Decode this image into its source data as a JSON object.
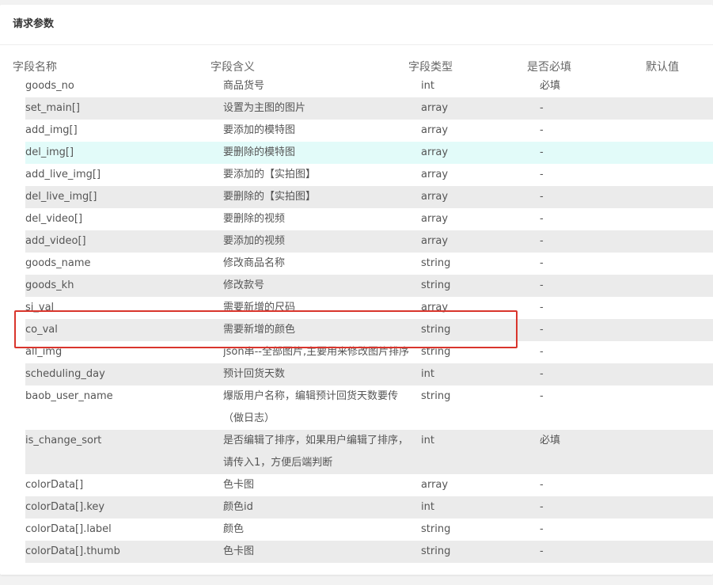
{
  "section": {
    "title": "请求参数"
  },
  "columns": {
    "name": "字段名称",
    "meaning": "字段含义",
    "type": "字段类型",
    "required": "是否必填",
    "default": "默认值"
  },
  "rows": [
    {
      "name": "goods_no",
      "desc": "商品货号",
      "type": "int",
      "required": "必填"
    },
    {
      "name": "set_main[]",
      "desc": "设置为主图的图片",
      "type": "array",
      "required": "-"
    },
    {
      "name": "add_img[]",
      "desc": "要添加的模特图",
      "type": "array",
      "required": "-"
    },
    {
      "name": "del_img[]",
      "desc": "要删除的模特图",
      "type": "array",
      "required": "-"
    },
    {
      "name": "add_live_img[]",
      "desc": "要添加的【实拍图】",
      "type": "array",
      "required": "-"
    },
    {
      "name": "del_live_img[]",
      "desc": "要删除的【实拍图】",
      "type": "array",
      "required": "-"
    },
    {
      "name": "del_video[]",
      "desc": "要删除的视频",
      "type": "array",
      "required": "-"
    },
    {
      "name": "add_video[]",
      "desc": "要添加的视频",
      "type": "array",
      "required": "-"
    },
    {
      "name": "goods_name",
      "desc": "修改商品名称",
      "type": "string",
      "required": "-"
    },
    {
      "name": "goods_kh",
      "desc": "修改款号",
      "type": "string",
      "required": "-"
    },
    {
      "name": "si_val",
      "desc": "需要新增的尺码",
      "type": "array",
      "required": "-"
    },
    {
      "name": "co_val",
      "desc": "需要新增的颜色",
      "type": "string",
      "required": "-"
    },
    {
      "name": "all_img",
      "desc": "json串--全部图片,主要用来修改图片排序",
      "type": "string",
      "required": "-"
    },
    {
      "name": "scheduling_day",
      "desc": "预计回货天数",
      "type": "int",
      "required": "-"
    },
    {
      "name": "baob_user_name",
      "desc": "爆版用户名称，编辑预计回货天数要传（做日志）",
      "type": "string",
      "required": "-"
    },
    {
      "name": "is_change_sort",
      "desc": "是否编辑了排序，如果用户编辑了排序，请传入1，方便后端判断",
      "type": "int",
      "required": "必填"
    },
    {
      "name": "colorData[]",
      "desc": "色卡图",
      "type": "array",
      "required": "-"
    },
    {
      "name": "colorData[].key",
      "desc": "颜色id",
      "type": "int",
      "required": "-"
    },
    {
      "name": "colorData[].label",
      "desc": "颜色",
      "type": "string",
      "required": "-"
    },
    {
      "name": "colorData[].thumb",
      "desc": "色卡图",
      "type": "string",
      "required": "-"
    }
  ],
  "highlight_color": "#d9352c",
  "hover_row_color": "#e2fbf9",
  "stripe_color": "#ebebeb"
}
